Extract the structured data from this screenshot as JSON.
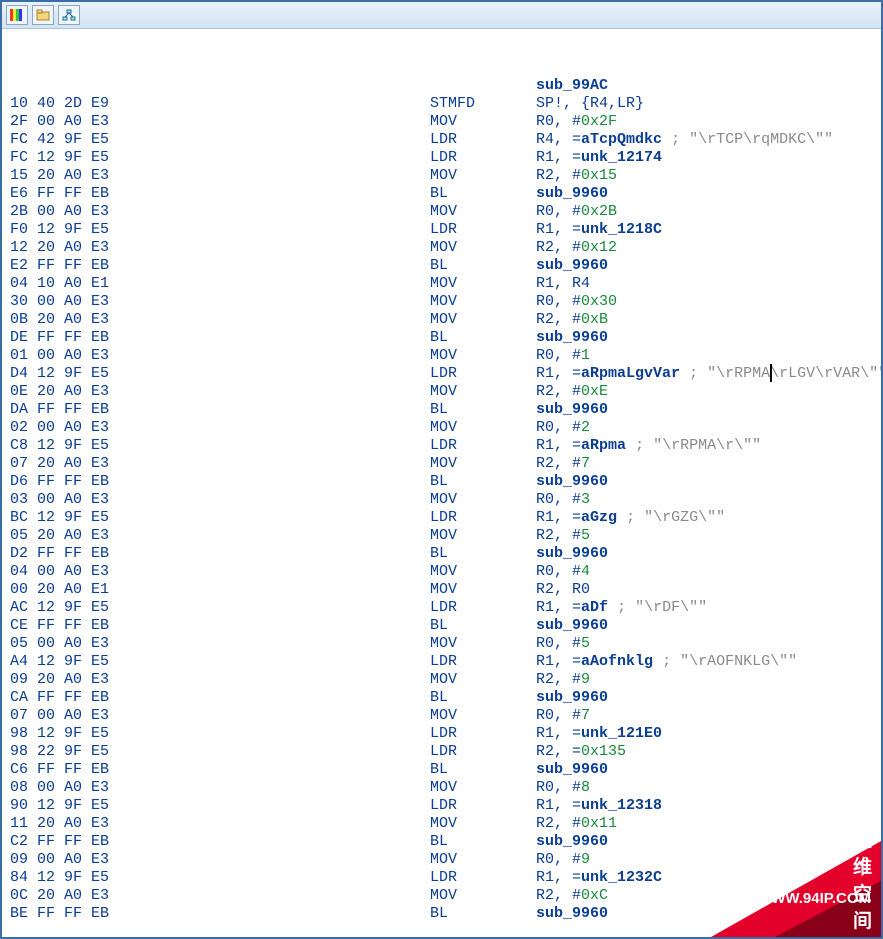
{
  "label": "sub_99AC",
  "watermark": {
    "url": "WWW.94IP.COM",
    "text": "IT运维空间"
  },
  "rows": [
    {
      "hex": "10 40 2D E9",
      "mn": "STMFD",
      "ops": [
        {
          "t": "reg",
          "v": "SP!"
        },
        {
          "t": "p",
          "v": ", "
        },
        {
          "t": "reg",
          "v": "{R4,LR}"
        }
      ]
    },
    {
      "hex": "2F 00 A0 E3",
      "mn": "MOV",
      "ops": [
        {
          "t": "reg",
          "v": "R0"
        },
        {
          "t": "p",
          "v": ", "
        },
        {
          "t": "reg",
          "v": "#"
        },
        {
          "t": "num",
          "v": "0x2F"
        }
      ]
    },
    {
      "hex": "FC 42 9F E5",
      "mn": "LDR",
      "ops": [
        {
          "t": "reg",
          "v": "R4"
        },
        {
          "t": "p",
          "v": ", "
        },
        {
          "t": "reg",
          "v": "="
        },
        {
          "t": "sym",
          "v": "aTcpQmdkc"
        },
        {
          "t": "cmt",
          "v": " ; \"\\rTCP\\rqMDKC\\\"\""
        }
      ]
    },
    {
      "hex": "FC 12 9F E5",
      "mn": "LDR",
      "ops": [
        {
          "t": "reg",
          "v": "R1"
        },
        {
          "t": "p",
          "v": ", "
        },
        {
          "t": "reg",
          "v": "="
        },
        {
          "t": "sym",
          "v": "unk_12174"
        }
      ]
    },
    {
      "hex": "15 20 A0 E3",
      "mn": "MOV",
      "ops": [
        {
          "t": "reg",
          "v": "R2"
        },
        {
          "t": "p",
          "v": ", "
        },
        {
          "t": "reg",
          "v": "#"
        },
        {
          "t": "num",
          "v": "0x15"
        }
      ]
    },
    {
      "hex": "E6 FF FF EB",
      "mn": "BL",
      "ops": [
        {
          "t": "sym",
          "v": "sub_9960"
        }
      ]
    },
    {
      "hex": "2B 00 A0 E3",
      "mn": "MOV",
      "ops": [
        {
          "t": "reg",
          "v": "R0"
        },
        {
          "t": "p",
          "v": ", "
        },
        {
          "t": "reg",
          "v": "#"
        },
        {
          "t": "num",
          "v": "0x2B"
        }
      ]
    },
    {
      "hex": "F0 12 9F E5",
      "mn": "LDR",
      "ops": [
        {
          "t": "reg",
          "v": "R1"
        },
        {
          "t": "p",
          "v": ", "
        },
        {
          "t": "reg",
          "v": "="
        },
        {
          "t": "sym",
          "v": "unk_1218C"
        }
      ]
    },
    {
      "hex": "12 20 A0 E3",
      "mn": "MOV",
      "ops": [
        {
          "t": "reg",
          "v": "R2"
        },
        {
          "t": "p",
          "v": ", "
        },
        {
          "t": "reg",
          "v": "#"
        },
        {
          "t": "num",
          "v": "0x12"
        }
      ]
    },
    {
      "hex": "E2 FF FF EB",
      "mn": "BL",
      "ops": [
        {
          "t": "sym",
          "v": "sub_9960"
        }
      ]
    },
    {
      "hex": "04 10 A0 E1",
      "mn": "MOV",
      "ops": [
        {
          "t": "reg",
          "v": "R1"
        },
        {
          "t": "p",
          "v": ", "
        },
        {
          "t": "reg",
          "v": "R4"
        }
      ]
    },
    {
      "hex": "30 00 A0 E3",
      "mn": "MOV",
      "ops": [
        {
          "t": "reg",
          "v": "R0"
        },
        {
          "t": "p",
          "v": ", "
        },
        {
          "t": "reg",
          "v": "#"
        },
        {
          "t": "num",
          "v": "0x30"
        }
      ]
    },
    {
      "hex": "0B 20 A0 E3",
      "mn": "MOV",
      "ops": [
        {
          "t": "reg",
          "v": "R2"
        },
        {
          "t": "p",
          "v": ", "
        },
        {
          "t": "reg",
          "v": "#"
        },
        {
          "t": "num",
          "v": "0xB"
        }
      ]
    },
    {
      "hex": "DE FF FF EB",
      "mn": "BL",
      "ops": [
        {
          "t": "sym",
          "v": "sub_9960"
        }
      ]
    },
    {
      "hex": "01 00 A0 E3",
      "mn": "MOV",
      "ops": [
        {
          "t": "reg",
          "v": "R0"
        },
        {
          "t": "p",
          "v": ", "
        },
        {
          "t": "reg",
          "v": "#"
        },
        {
          "t": "num",
          "v": "1"
        }
      ]
    },
    {
      "hex": "D4 12 9F E5",
      "mn": "LDR",
      "ops": [
        {
          "t": "reg",
          "v": "R1"
        },
        {
          "t": "p",
          "v": ", "
        },
        {
          "t": "reg",
          "v": "="
        },
        {
          "t": "sym",
          "v": "aRpmaLgvVar"
        },
        {
          "t": "cmt",
          "v": " ; \"\\rRPMA\\rLGV\\rVAR\\\"\""
        }
      ]
    },
    {
      "hex": "0E 20 A0 E3",
      "mn": "MOV",
      "ops": [
        {
          "t": "reg",
          "v": "R2"
        },
        {
          "t": "p",
          "v": ", "
        },
        {
          "t": "reg",
          "v": "#"
        },
        {
          "t": "num",
          "v": "0xE"
        }
      ]
    },
    {
      "hex": "DA FF FF EB",
      "mn": "BL",
      "ops": [
        {
          "t": "sym",
          "v": "sub_9960"
        }
      ]
    },
    {
      "hex": "02 00 A0 E3",
      "mn": "MOV",
      "ops": [
        {
          "t": "reg",
          "v": "R0"
        },
        {
          "t": "p",
          "v": ", "
        },
        {
          "t": "reg",
          "v": "#"
        },
        {
          "t": "num",
          "v": "2"
        }
      ]
    },
    {
      "hex": "C8 12 9F E5",
      "mn": "LDR",
      "ops": [
        {
          "t": "reg",
          "v": "R1"
        },
        {
          "t": "p",
          "v": ", "
        },
        {
          "t": "reg",
          "v": "="
        },
        {
          "t": "sym",
          "v": "aRpma"
        },
        {
          "t": "cmt",
          "v": " ; \"\\rRPMA\\r\\\"\""
        }
      ]
    },
    {
      "hex": "07 20 A0 E3",
      "mn": "MOV",
      "ops": [
        {
          "t": "reg",
          "v": "R2"
        },
        {
          "t": "p",
          "v": ", "
        },
        {
          "t": "reg",
          "v": "#"
        },
        {
          "t": "num",
          "v": "7"
        }
      ]
    },
    {
      "hex": "D6 FF FF EB",
      "mn": "BL",
      "ops": [
        {
          "t": "sym",
          "v": "sub_9960"
        }
      ]
    },
    {
      "hex": "03 00 A0 E3",
      "mn": "MOV",
      "ops": [
        {
          "t": "reg",
          "v": "R0"
        },
        {
          "t": "p",
          "v": ", "
        },
        {
          "t": "reg",
          "v": "#"
        },
        {
          "t": "num",
          "v": "3"
        }
      ]
    },
    {
      "hex": "BC 12 9F E5",
      "mn": "LDR",
      "ops": [
        {
          "t": "reg",
          "v": "R1"
        },
        {
          "t": "p",
          "v": ", "
        },
        {
          "t": "reg",
          "v": "="
        },
        {
          "t": "sym",
          "v": "aGzg"
        },
        {
          "t": "cmt",
          "v": " ; \"\\rGZG\\\"\""
        }
      ]
    },
    {
      "hex": "05 20 A0 E3",
      "mn": "MOV",
      "ops": [
        {
          "t": "reg",
          "v": "R2"
        },
        {
          "t": "p",
          "v": ", "
        },
        {
          "t": "reg",
          "v": "#"
        },
        {
          "t": "num",
          "v": "5"
        }
      ]
    },
    {
      "hex": "D2 FF FF EB",
      "mn": "BL",
      "ops": [
        {
          "t": "sym",
          "v": "sub_9960"
        }
      ]
    },
    {
      "hex": "04 00 A0 E3",
      "mn": "MOV",
      "ops": [
        {
          "t": "reg",
          "v": "R0"
        },
        {
          "t": "p",
          "v": ", "
        },
        {
          "t": "reg",
          "v": "#"
        },
        {
          "t": "num",
          "v": "4"
        }
      ]
    },
    {
      "hex": "00 20 A0 E1",
      "mn": "MOV",
      "ops": [
        {
          "t": "reg",
          "v": "R2"
        },
        {
          "t": "p",
          "v": ", "
        },
        {
          "t": "reg",
          "v": "R0"
        }
      ]
    },
    {
      "hex": "AC 12 9F E5",
      "mn": "LDR",
      "ops": [
        {
          "t": "reg",
          "v": "R1"
        },
        {
          "t": "p",
          "v": ", "
        },
        {
          "t": "reg",
          "v": "="
        },
        {
          "t": "sym",
          "v": "aDf"
        },
        {
          "t": "cmt",
          "v": " ; \"\\rDF\\\"\""
        }
      ]
    },
    {
      "hex": "CE FF FF EB",
      "mn": "BL",
      "ops": [
        {
          "t": "sym",
          "v": "sub_9960"
        }
      ]
    },
    {
      "hex": "05 00 A0 E3",
      "mn": "MOV",
      "ops": [
        {
          "t": "reg",
          "v": "R0"
        },
        {
          "t": "p",
          "v": ", "
        },
        {
          "t": "reg",
          "v": "#"
        },
        {
          "t": "num",
          "v": "5"
        }
      ]
    },
    {
      "hex": "A4 12 9F E5",
      "mn": "LDR",
      "ops": [
        {
          "t": "reg",
          "v": "R1"
        },
        {
          "t": "p",
          "v": ", "
        },
        {
          "t": "reg",
          "v": "="
        },
        {
          "t": "sym",
          "v": "aAofnklg"
        },
        {
          "t": "cmt",
          "v": " ; \"\\rAOFNKLG\\\"\""
        }
      ]
    },
    {
      "hex": "09 20 A0 E3",
      "mn": "MOV",
      "ops": [
        {
          "t": "reg",
          "v": "R2"
        },
        {
          "t": "p",
          "v": ", "
        },
        {
          "t": "reg",
          "v": "#"
        },
        {
          "t": "num",
          "v": "9"
        }
      ]
    },
    {
      "hex": "CA FF FF EB",
      "mn": "BL",
      "ops": [
        {
          "t": "sym",
          "v": "sub_9960"
        }
      ]
    },
    {
      "hex": "07 00 A0 E3",
      "mn": "MOV",
      "ops": [
        {
          "t": "reg",
          "v": "R0"
        },
        {
          "t": "p",
          "v": ", "
        },
        {
          "t": "reg",
          "v": "#"
        },
        {
          "t": "num",
          "v": "7"
        }
      ]
    },
    {
      "hex": "98 12 9F E5",
      "mn": "LDR",
      "ops": [
        {
          "t": "reg",
          "v": "R1"
        },
        {
          "t": "p",
          "v": ", "
        },
        {
          "t": "reg",
          "v": "="
        },
        {
          "t": "sym",
          "v": "unk_121E0"
        }
      ]
    },
    {
      "hex": "98 22 9F E5",
      "mn": "LDR",
      "ops": [
        {
          "t": "reg",
          "v": "R2"
        },
        {
          "t": "p",
          "v": ", "
        },
        {
          "t": "reg",
          "v": "="
        },
        {
          "t": "num",
          "v": "0x135"
        }
      ]
    },
    {
      "hex": "C6 FF FF EB",
      "mn": "BL",
      "ops": [
        {
          "t": "sym",
          "v": "sub_9960"
        }
      ]
    },
    {
      "hex": "08 00 A0 E3",
      "mn": "MOV",
      "ops": [
        {
          "t": "reg",
          "v": "R0"
        },
        {
          "t": "p",
          "v": ", "
        },
        {
          "t": "reg",
          "v": "#"
        },
        {
          "t": "num",
          "v": "8"
        }
      ]
    },
    {
      "hex": "90 12 9F E5",
      "mn": "LDR",
      "ops": [
        {
          "t": "reg",
          "v": "R1"
        },
        {
          "t": "p",
          "v": ", "
        },
        {
          "t": "reg",
          "v": "="
        },
        {
          "t": "sym",
          "v": "unk_12318"
        }
      ]
    },
    {
      "hex": "11 20 A0 E3",
      "mn": "MOV",
      "ops": [
        {
          "t": "reg",
          "v": "R2"
        },
        {
          "t": "p",
          "v": ", "
        },
        {
          "t": "reg",
          "v": "#"
        },
        {
          "t": "num",
          "v": "0x11"
        }
      ]
    },
    {
      "hex": "C2 FF FF EB",
      "mn": "BL",
      "ops": [
        {
          "t": "sym",
          "v": "sub_9960"
        }
      ]
    },
    {
      "hex": "09 00 A0 E3",
      "mn": "MOV",
      "ops": [
        {
          "t": "reg",
          "v": "R0"
        },
        {
          "t": "p",
          "v": ", "
        },
        {
          "t": "reg",
          "v": "#"
        },
        {
          "t": "num",
          "v": "9"
        }
      ]
    },
    {
      "hex": "84 12 9F E5",
      "mn": "LDR",
      "ops": [
        {
          "t": "reg",
          "v": "R1"
        },
        {
          "t": "p",
          "v": ", "
        },
        {
          "t": "reg",
          "v": "="
        },
        {
          "t": "sym",
          "v": "unk_1232C"
        }
      ]
    },
    {
      "hex": "0C 20 A0 E3",
      "mn": "MOV",
      "ops": [
        {
          "t": "reg",
          "v": "R2"
        },
        {
          "t": "p",
          "v": ", "
        },
        {
          "t": "reg",
          "v": "#"
        },
        {
          "t": "num",
          "v": "0xC"
        }
      ]
    },
    {
      "hex": "BE FF FF EB",
      "mn": "BL",
      "ops": [
        {
          "t": "sym",
          "v": "sub_9960"
        }
      ]
    }
  ]
}
